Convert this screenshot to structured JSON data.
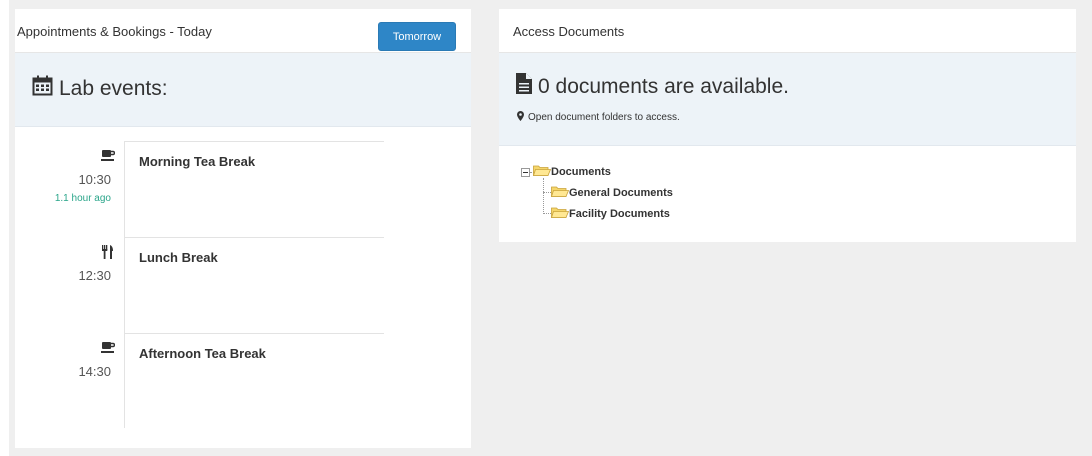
{
  "appointments": {
    "header_title": "Appointments & Bookings - Today",
    "tomorrow_label": "Tomorrow",
    "hero_title": "Lab events:",
    "events": [
      {
        "icon": "coffee-icon",
        "time": "10:30",
        "ago": "1.1 hour ago",
        "title": "Morning Tea Break"
      },
      {
        "icon": "cutlery-icon",
        "time": "12:30",
        "ago": "",
        "title": "Lunch Break"
      },
      {
        "icon": "coffee-icon",
        "time": "14:30",
        "ago": "",
        "title": "Afternoon Tea Break"
      }
    ]
  },
  "documents": {
    "header_title": "Access Documents",
    "hero_title": "0 documents are available.",
    "hero_sub": "Open document folders to access.",
    "tree": {
      "root": "Documents",
      "children": [
        "General Documents",
        "Facility Documents"
      ]
    }
  },
  "colors": {
    "accent": "#2e86c7",
    "hero_bg": "#edf3f8",
    "ago_text": "#2aa58a",
    "page_bg": "#efefef"
  }
}
